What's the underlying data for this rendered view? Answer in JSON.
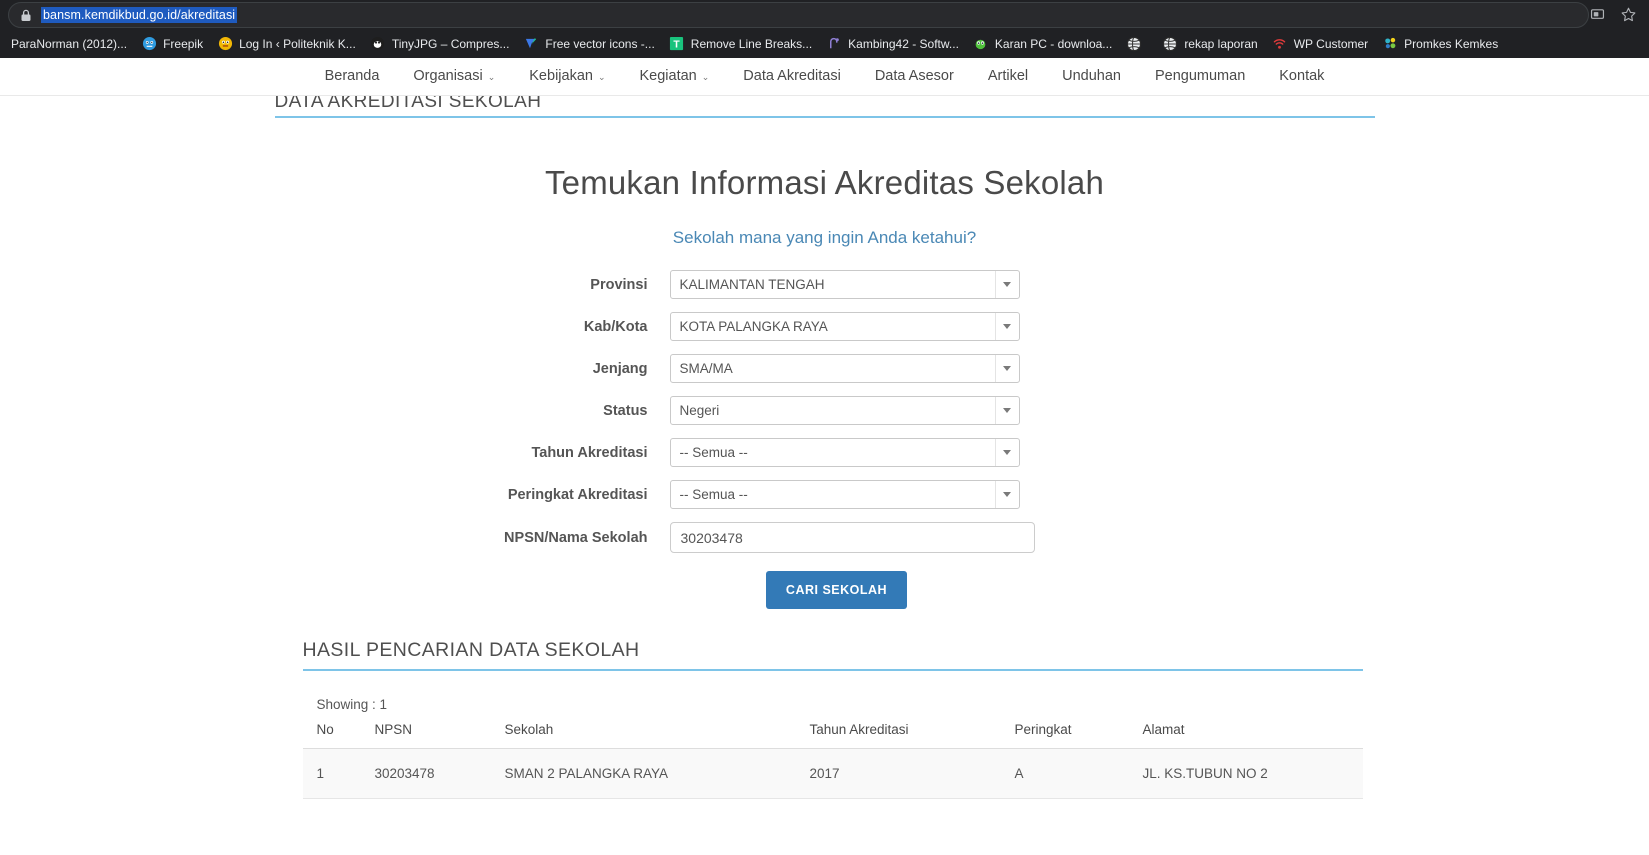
{
  "browser": {
    "url": "bansm.kemdikbud.go.id/akreditasi",
    "lock_icon": "lock-icon",
    "cast_icon": "cast-icon",
    "star_icon": "star-bookmark-icon",
    "bookmarks": [
      {
        "label": "ParaNorman (2012)...",
        "icon": "none"
      },
      {
        "label": "Freepik",
        "icon": "freepik-icon"
      },
      {
        "label": "Log In ‹ Politeknik K...",
        "icon": "wordpress-icon"
      },
      {
        "label": "TinyJPG – Compres...",
        "icon": "tinyjpg-icon"
      },
      {
        "label": "Free vector icons -...",
        "icon": "flaticon-icon"
      },
      {
        "label": "Remove Line Breaks...",
        "icon": "textfixer-icon"
      },
      {
        "label": "Kambing42 - Softw...",
        "icon": "kambing-icon"
      },
      {
        "label": "Karan PC - downloa...",
        "icon": "karanpc-icon"
      },
      {
        "label": "",
        "icon": "globe-icon"
      },
      {
        "label": "rekap laporan",
        "icon": "globe-icon"
      },
      {
        "label": "WP Customer",
        "icon": "wifi-icon"
      },
      {
        "label": "Promkes Kemkes",
        "icon": "promkes-icon"
      }
    ]
  },
  "nav": {
    "items": [
      {
        "label": "Beranda",
        "dropdown": false
      },
      {
        "label": "Organisasi",
        "dropdown": true
      },
      {
        "label": "Kebijakan",
        "dropdown": true
      },
      {
        "label": "Kegiatan",
        "dropdown": true
      },
      {
        "label": "Data Akreditasi",
        "dropdown": false
      },
      {
        "label": "Data Asesor",
        "dropdown": false
      },
      {
        "label": "Artikel",
        "dropdown": false
      },
      {
        "label": "Unduhan",
        "dropdown": false
      },
      {
        "label": "Pengumuman",
        "dropdown": false
      },
      {
        "label": "Kontak",
        "dropdown": false
      }
    ],
    "caret_glyph": "⌄"
  },
  "page": {
    "section_title": "DATA AKREDITASI SEKOLAH",
    "heading": "Temukan Informasi Akreditas Sekolah",
    "subheading": "Sekolah mana yang ingin Anda ketahui?",
    "accent_color": "#7ec4e8"
  },
  "form": {
    "fields": [
      {
        "label": "Provinsi",
        "type": "select",
        "value": "KALIMANTAN TENGAH"
      },
      {
        "label": "Kab/Kota",
        "type": "select",
        "value": "KOTA PALANGKA RAYA"
      },
      {
        "label": "Jenjang",
        "type": "select",
        "value": "SMA/MA"
      },
      {
        "label": "Status",
        "type": "select",
        "value": "Negeri"
      },
      {
        "label": "Tahun Akreditasi",
        "type": "select",
        "value": "-- Semua --"
      },
      {
        "label": "Peringkat Akreditasi",
        "type": "select",
        "value": "-- Semua --"
      },
      {
        "label": "NPSN/Nama Sekolah",
        "type": "text",
        "value": "30203478",
        "placeholder": ""
      }
    ],
    "submit_label": "CARI SEKOLAH",
    "submit_color": "#337ab7"
  },
  "results": {
    "title": "HASIL PENCARIAN DATA SEKOLAH",
    "showing": "Showing : 1",
    "columns": [
      "No",
      "NPSN",
      "Sekolah",
      "Tahun Akreditasi",
      "Peringkat",
      "Alamat"
    ],
    "rows": [
      {
        "no": "1",
        "npsn": "30203478",
        "sekolah": "SMAN 2 PALANGKA RAYA",
        "tahun": "2017",
        "peringkat": "A",
        "alamat": "JL. KS.TUBUN NO 2"
      }
    ],
    "npsn_link_color": "#a3712b"
  }
}
